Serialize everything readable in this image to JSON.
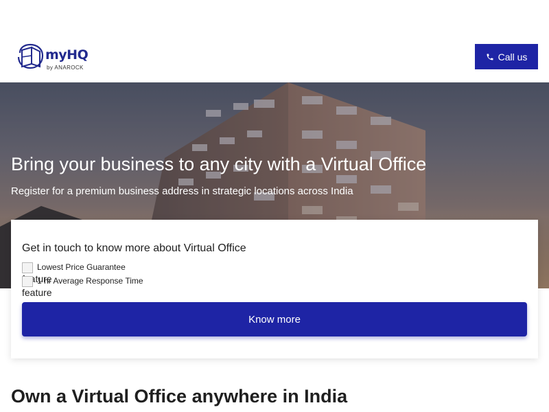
{
  "header": {
    "logo_text": "myHQ",
    "logo_sub": "by ANAROCK",
    "call_label": "Call us"
  },
  "hero": {
    "title": "Bring your business to any city with a Virtual Office",
    "subtitle": "Register for a premium business address in strategic locations across India"
  },
  "card": {
    "title": "Get in touch to know more about Virtual Office",
    "features": [
      {
        "alt": "feature",
        "text": "Lowest Price Guarantee"
      },
      {
        "alt": "feature",
        "text": "1 hr Average Response Time"
      }
    ],
    "button_label": "Know more"
  },
  "section": {
    "title": "Own a Virtual Office anywhere in India"
  },
  "colors": {
    "brand": "#1e24a5",
    "logo": "#222a8e",
    "text": "#1f1f1f"
  },
  "icons": {
    "call": "phone-icon",
    "logo": "myhq-logo-mark",
    "feature": "broken-image-icon"
  }
}
